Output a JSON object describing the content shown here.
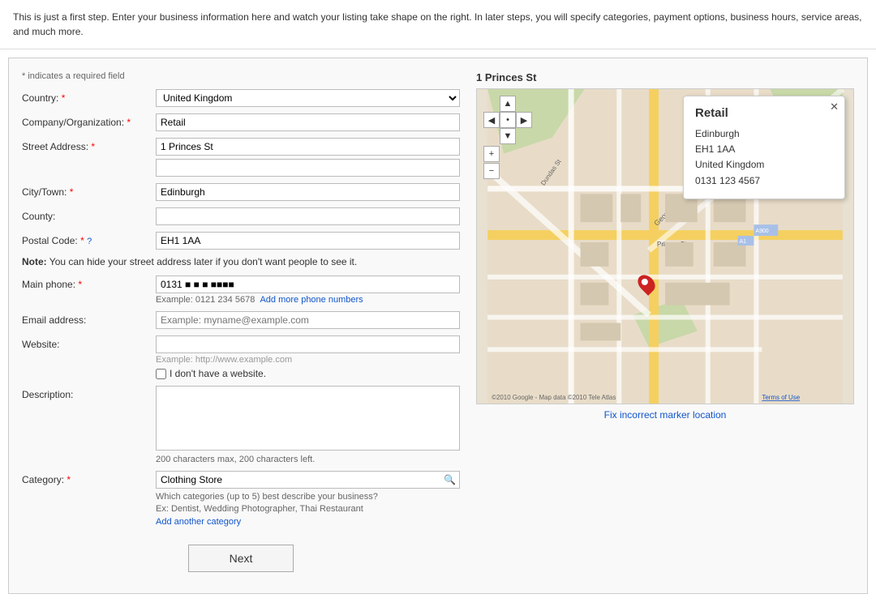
{
  "top_text": "This is just a first step. Enter your business information here and watch your listing take shape on the right. In later steps, you will specify categories, payment options, business hours, service areas, and much more.",
  "required_note": "* indicates a required field",
  "form": {
    "country_label": "Country:",
    "country_required": true,
    "country_value": "United Kingdom",
    "company_label": "Company/Organization:",
    "company_required": true,
    "company_value": "Retail",
    "street_label": "Street Address:",
    "street_required": true,
    "street_line1": "1 Princes St",
    "street_line2": "",
    "city_label": "City/Town:",
    "city_required": true,
    "city_value": "Edinburgh",
    "county_label": "County:",
    "county_value": "",
    "postal_label": "Postal Code:",
    "postal_required": true,
    "postal_value": "EH1 1AA",
    "note_label": "Note:",
    "note_text": "You can hide your street address later if you don't want people to see it.",
    "phone_label": "Main phone:",
    "phone_required": true,
    "phone_value": "0131 ■ ■ ■ ■■■■",
    "phone_example": "Example: 0121 234 5678",
    "phone_add_link": "Add more phone numbers",
    "email_label": "Email address:",
    "email_placeholder": "Example: myname@example.com",
    "website_label": "Website:",
    "website_placeholder": "Example: http://www.example.com",
    "no_website_label": "I don't have a website.",
    "description_label": "Description:",
    "description_hint": "200 characters max, 200 characters left.",
    "category_label": "Category:",
    "category_required": true,
    "category_value": "Clothing Store",
    "category_hint1": "Which categories (up to 5) best describe your business?",
    "category_hint2": "Ex: Dentist, Wedding Photographer, Thai Restaurant",
    "add_category_link": "Add another category",
    "next_button": "Next"
  },
  "map": {
    "address_title": "1 Princes St",
    "popup": {
      "title": "Retail",
      "line1": "Edinburgh",
      "line2": "EH1 1AA",
      "line3": "United Kingdom",
      "line4": "0131 123 4567"
    },
    "fix_link": "Fix incorrect marker location",
    "copyright": "©2010 Google - Map data ©2010 Tele Atlas",
    "terms": "Terms of Use"
  },
  "icons": {
    "zoom_in": "+",
    "zoom_out": "−",
    "nav_up": "▲",
    "nav_left": "◀",
    "nav_right": "▶",
    "nav_down": "▼",
    "close": "✕",
    "search": "🔍"
  }
}
